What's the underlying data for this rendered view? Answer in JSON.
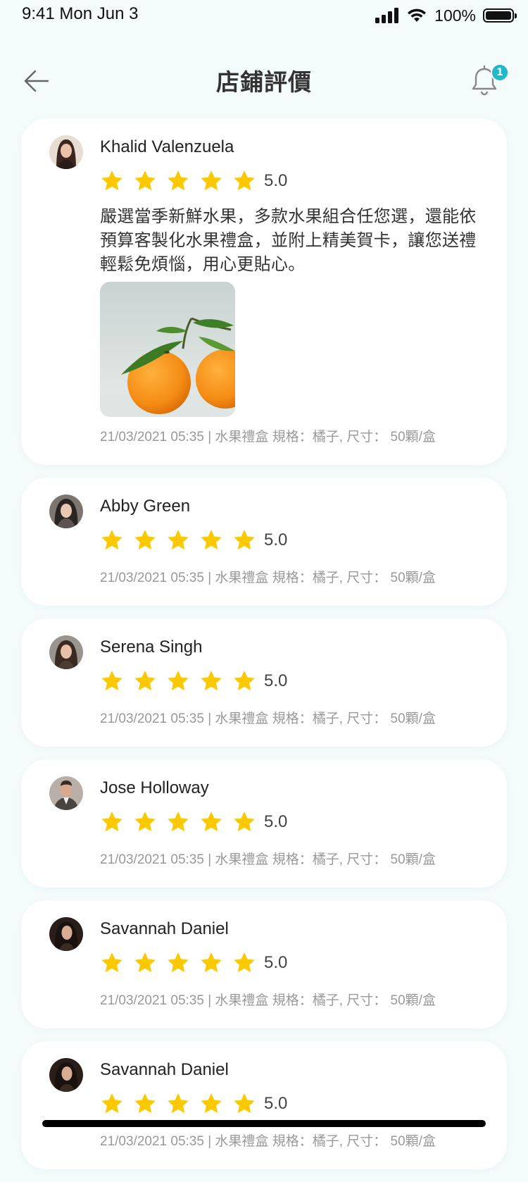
{
  "status_bar": {
    "time": "9:41  Mon Jun 3",
    "battery_percent": "100%"
  },
  "header": {
    "title": "店鋪評價",
    "notification_count": "1"
  },
  "reviews": [
    {
      "name": "Khalid Valenzuela",
      "rating": "5.0",
      "stars": 5,
      "text": "嚴選當季新鮮水果，多款水果組合任您選，還能依預算客製化水果禮盒，並附上精美賀卡，讓您送禮輕鬆免煩惱，用心更貼心。",
      "has_photo": true,
      "meta": "21/03/2021 05:35 | 水果禮盒 規格：橘子, 尺寸： 50顆/盒"
    },
    {
      "name": "Abby Green",
      "rating": "5.0",
      "stars": 5,
      "meta": "21/03/2021 05:35 | 水果禮盒 規格：橘子, 尺寸： 50顆/盒"
    },
    {
      "name": "Serena Singh",
      "rating": "5.0",
      "stars": 5,
      "meta": "21/03/2021 05:35 | 水果禮盒 規格：橘子, 尺寸： 50顆/盒"
    },
    {
      "name": "Jose Holloway",
      "rating": "5.0",
      "stars": 5,
      "meta": "21/03/2021 05:35 | 水果禮盒 規格：橘子, 尺寸： 50顆/盒"
    },
    {
      "name": "Savannah Daniel",
      "rating": "5.0",
      "stars": 5,
      "meta": "21/03/2021 05:35 | 水果禮盒 規格：橘子, 尺寸： 50顆/盒"
    },
    {
      "name": "Savannah Daniel",
      "rating": "5.0",
      "stars": 5,
      "meta": "21/03/2021 05:35 | 水果禮盒 規格：橘子, 尺寸： 50顆/盒"
    }
  ],
  "colors": {
    "star": "#fcc800",
    "accent": "#23b8c8",
    "background": "#f4fbfb"
  },
  "icons": [
    "back-arrow-icon",
    "bell-icon",
    "star-icon",
    "signal-icon",
    "wifi-icon",
    "battery-icon"
  ]
}
